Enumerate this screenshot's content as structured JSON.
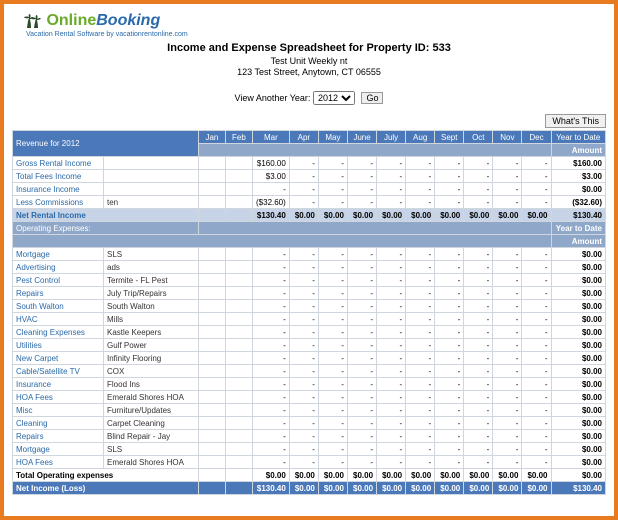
{
  "logo": {
    "online": "Online",
    "booking": "Booking",
    "tagline": "Vacation Rental Software by vacationrentonline.com"
  },
  "header": {
    "title": "Income and Expense Spreadsheet for Property ID: 533",
    "subtitle": "Test Unit Weekly nt",
    "address": "123 Test Street, Anytown, CT 06555"
  },
  "year_picker": {
    "label": "View Another Year:",
    "selected": "2012",
    "go": "Go"
  },
  "whats_this": "What's This",
  "months": [
    "Jan",
    "Feb",
    "Mar",
    "Apr",
    "May",
    "June",
    "July",
    "Aug",
    "Sept",
    "Oct",
    "Nov",
    "Dec"
  ],
  "ytd_header": "Year to Date",
  "amount_header": "Amount",
  "revenue_header": "Revenue for 2012",
  "revenue_rows": [
    {
      "label": "Gross Rental Income",
      "vendor": "",
      "vals": [
        "",
        "",
        "$160.00",
        "-",
        "-",
        "-",
        "-",
        "-",
        "-",
        "-",
        "-",
        "-"
      ],
      "ytd": "$160.00"
    },
    {
      "label": "Total Fees Income",
      "vendor": "",
      "vals": [
        "",
        "",
        "$3.00",
        "-",
        "-",
        "-",
        "-",
        "-",
        "-",
        "-",
        "-",
        "-"
      ],
      "ytd": "$3.00"
    },
    {
      "label": "Insurance Income",
      "vendor": "",
      "vals": [
        "",
        "",
        "-",
        "-",
        "-",
        "-",
        "-",
        "-",
        "-",
        "-",
        "-",
        "-"
      ],
      "ytd": "$0.00"
    },
    {
      "label": "Less Commissions",
      "vendor": "ten",
      "vals": [
        "",
        "",
        "($32.60)",
        "-",
        "-",
        "-",
        "-",
        "-",
        "-",
        "-",
        "-",
        "-"
      ],
      "ytd": "($32.60)"
    }
  ],
  "net_rental": {
    "label": "Net Rental Income",
    "vals": [
      "",
      "",
      "$130.40",
      "$0.00",
      "$0.00",
      "$0.00",
      "$0.00",
      "$0.00",
      "$0.00",
      "$0.00",
      "$0.00",
      "$0.00"
    ],
    "ytd": "$130.40"
  },
  "opex_header": "Operating Expenses:",
  "opex_rows": [
    {
      "label": "Mortgage",
      "vendor": "SLS",
      "vals": [
        "",
        "",
        "-",
        "-",
        "-",
        "-",
        "-",
        "-",
        "-",
        "-",
        "-",
        "-"
      ],
      "ytd": "$0.00"
    },
    {
      "label": "Advertising",
      "vendor": "ads",
      "vals": [
        "",
        "",
        "-",
        "-",
        "-",
        "-",
        "-",
        "-",
        "-",
        "-",
        "-",
        "-"
      ],
      "ytd": "$0.00"
    },
    {
      "label": "Pest Control",
      "vendor": "Termite - FL Pest",
      "vals": [
        "",
        "",
        "-",
        "-",
        "-",
        "-",
        "-",
        "-",
        "-",
        "-",
        "-",
        "-"
      ],
      "ytd": "$0.00"
    },
    {
      "label": "Repairs",
      "vendor": "July Trip/Repairs",
      "vals": [
        "",
        "",
        "-",
        "-",
        "-",
        "-",
        "-",
        "-",
        "-",
        "-",
        "-",
        "-"
      ],
      "ytd": "$0.00"
    },
    {
      "label": "South Walton",
      "vendor": "South Walton",
      "vals": [
        "",
        "",
        "-",
        "-",
        "-",
        "-",
        "-",
        "-",
        "-",
        "-",
        "-",
        "-"
      ],
      "ytd": "$0.00"
    },
    {
      "label": "HVAC",
      "vendor": "Mills",
      "vals": [
        "",
        "",
        "-",
        "-",
        "-",
        "-",
        "-",
        "-",
        "-",
        "-",
        "-",
        "-"
      ],
      "ytd": "$0.00"
    },
    {
      "label": "Cleaning Expenses",
      "vendor": "Kastle Keepers",
      "vals": [
        "",
        "",
        "-",
        "-",
        "-",
        "-",
        "-",
        "-",
        "-",
        "-",
        "-",
        "-"
      ],
      "ytd": "$0.00"
    },
    {
      "label": "Utilities",
      "vendor": "Gulf Power",
      "vals": [
        "",
        "",
        "-",
        "-",
        "-",
        "-",
        "-",
        "-",
        "-",
        "-",
        "-",
        "-"
      ],
      "ytd": "$0.00"
    },
    {
      "label": "New Carpet",
      "vendor": "Infinity Flooring",
      "vals": [
        "",
        "",
        "-",
        "-",
        "-",
        "-",
        "-",
        "-",
        "-",
        "-",
        "-",
        "-"
      ],
      "ytd": "$0.00"
    },
    {
      "label": "Cable/Satellite TV",
      "vendor": "COX",
      "vals": [
        "",
        "",
        "-",
        "-",
        "-",
        "-",
        "-",
        "-",
        "-",
        "-",
        "-",
        "-"
      ],
      "ytd": "$0.00"
    },
    {
      "label": "Insurance",
      "vendor": "Flood Ins",
      "vals": [
        "",
        "",
        "-",
        "-",
        "-",
        "-",
        "-",
        "-",
        "-",
        "-",
        "-",
        "-"
      ],
      "ytd": "$0.00"
    },
    {
      "label": "HOA Fees",
      "vendor": "Emerald Shores HOA",
      "vals": [
        "",
        "",
        "-",
        "-",
        "-",
        "-",
        "-",
        "-",
        "-",
        "-",
        "-",
        "-"
      ],
      "ytd": "$0.00"
    },
    {
      "label": "Misc",
      "vendor": "Furniture/Updates",
      "vals": [
        "",
        "",
        "-",
        "-",
        "-",
        "-",
        "-",
        "-",
        "-",
        "-",
        "-",
        "-"
      ],
      "ytd": "$0.00"
    },
    {
      "label": "Cleaning",
      "vendor": "Carpet Cleaning",
      "vals": [
        "",
        "",
        "-",
        "-",
        "-",
        "-",
        "-",
        "-",
        "-",
        "-",
        "-",
        "-"
      ],
      "ytd": "$0.00"
    },
    {
      "label": "Repairs",
      "vendor": "Blind Repair - Jay",
      "vals": [
        "",
        "",
        "-",
        "-",
        "-",
        "-",
        "-",
        "-",
        "-",
        "-",
        "-",
        "-"
      ],
      "ytd": "$0.00"
    },
    {
      "label": "Mortgage",
      "vendor": "SLS",
      "vals": [
        "",
        "",
        "-",
        "-",
        "-",
        "-",
        "-",
        "-",
        "-",
        "-",
        "-",
        "-"
      ],
      "ytd": "$0.00"
    },
    {
      "label": "HOA Fees",
      "vendor": "Emerald Shores HOA",
      "vals": [
        "",
        "",
        "-",
        "-",
        "-",
        "-",
        "-",
        "-",
        "-",
        "-",
        "-",
        "-"
      ],
      "ytd": "$0.00"
    }
  ],
  "total_opex": {
    "label": "Total Operating expenses",
    "vals": [
      "",
      "",
      "$0.00",
      "$0.00",
      "$0.00",
      "$0.00",
      "$0.00",
      "$0.00",
      "$0.00",
      "$0.00",
      "$0.00",
      "$0.00"
    ],
    "ytd": "$0.00"
  },
  "net_income": {
    "label": "Net Income (Loss)",
    "vals": [
      "",
      "",
      "$130.40",
      "$0.00",
      "$0.00",
      "$0.00",
      "$0.00",
      "$0.00",
      "$0.00",
      "$0.00",
      "$0.00",
      "$0.00"
    ],
    "ytd": "$130.40"
  }
}
